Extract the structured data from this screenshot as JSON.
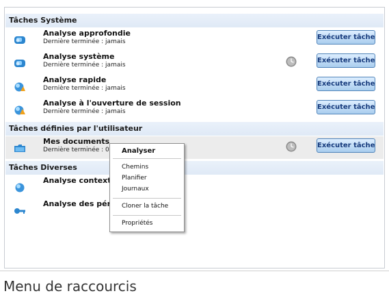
{
  "sections": [
    {
      "title": "Tâches Système",
      "tasks": [
        {
          "name": "Analyse approfondie",
          "last": "Dernière terminée : jamais",
          "action": "Exécuter tâche",
          "icon": "scan-deep-icon",
          "clock": false
        },
        {
          "name": "Analyse système",
          "last": "Dernière terminée : jamais",
          "action": "Exécuter tâche",
          "icon": "scan-system-icon",
          "clock": true
        },
        {
          "name": "Analyse rapide",
          "last": "Dernière terminée : jamais",
          "action": "Exécuter tâche",
          "icon": "scan-quick-icon",
          "clock": false
        },
        {
          "name": "Analyse à l'ouverture de session",
          "last": "Dernière terminée : jamais",
          "action": "Exécuter tâche",
          "icon": "scan-logon-icon",
          "clock": false
        }
      ]
    },
    {
      "title": "Tâches définies par l'utilisateur",
      "tasks": [
        {
          "name": "Mes documents",
          "last": "Dernière terminée : 0",
          "action": "Exécuter tâche",
          "icon": "folder-scan-icon",
          "clock": true,
          "selected": true
        }
      ]
    },
    {
      "title": "Tâches Diverses",
      "tasks": [
        {
          "name": "Analyse contextue",
          "icon": "context-scan-icon"
        },
        {
          "name": "Analyse des périph",
          "icon": "device-scan-icon"
        }
      ]
    }
  ],
  "context_menu": {
    "items": [
      "Analyser",
      "Chemins",
      "Planifier",
      "Journaux",
      "Cloner la tâche",
      "Propriétés"
    ]
  },
  "caption": "Menu de raccourcis"
}
